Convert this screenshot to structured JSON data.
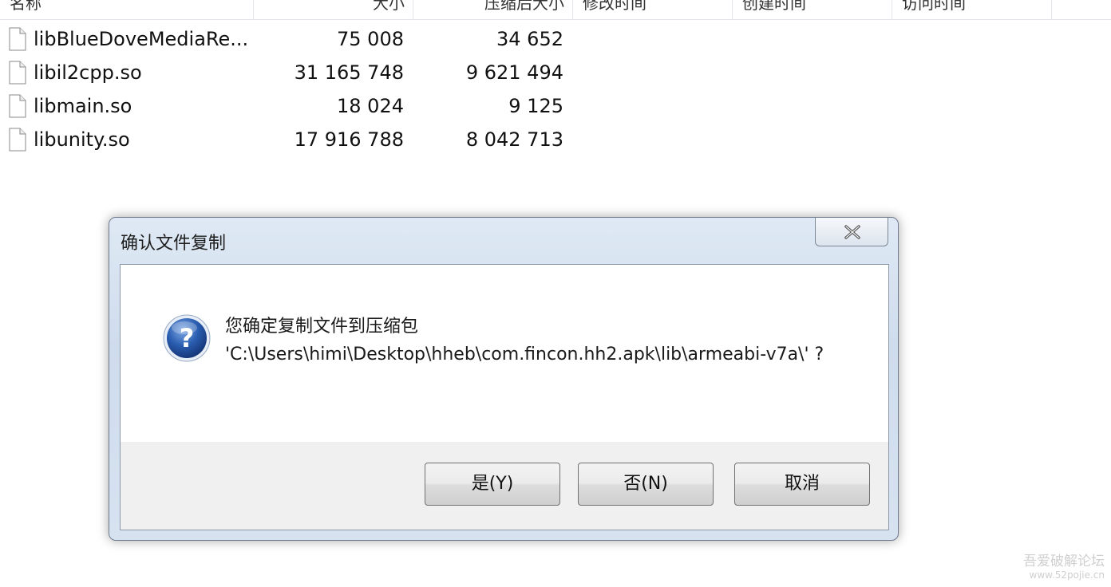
{
  "columns": {
    "name": "名称",
    "size": "大小",
    "packed": "压缩后大小",
    "modified": "修改时间",
    "created": "创建时间",
    "accessed": "访问时间"
  },
  "files": [
    {
      "name": "libBlueDoveMediaRe...",
      "size": "75 008",
      "packed": "34 652",
      "icon": "file-icon"
    },
    {
      "name": "libil2cpp.so",
      "size": "31 165 748",
      "packed": "9 621 494",
      "icon": "file-icon"
    },
    {
      "name": "libmain.so",
      "size": "18 024",
      "packed": "9 125",
      "icon": "file-icon"
    },
    {
      "name": "libunity.so",
      "size": "17 916 788",
      "packed": "8 042 713",
      "icon": "file-icon"
    }
  ],
  "dialog": {
    "title": "确认文件复制",
    "message_line1": "您确定复制文件到压缩包",
    "message_path": "'C:\\Users\\himi\\Desktop\\hheb\\com.fincon.hh2.apk\\lib\\armeabi-v7a\\' ?",
    "icon": "question-icon",
    "buttons": {
      "yes": "是(Y)",
      "no": "否(N)",
      "cancel": "取消"
    }
  },
  "watermark": {
    "line1": "吾爱破解论坛",
    "line2": "www.52pojie.cn"
  },
  "colors": {
    "dialog_frame": "#cfdcec",
    "question_blue": "#2a5db0"
  }
}
